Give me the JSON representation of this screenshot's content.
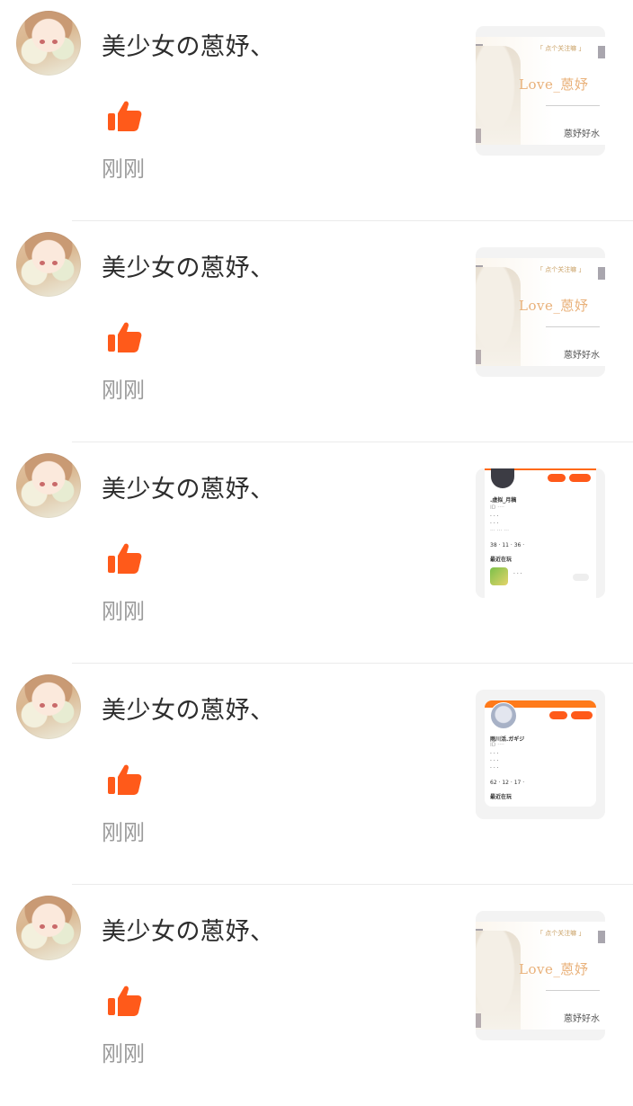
{
  "notifications": [
    {
      "user": "美少女の蒽妤、",
      "time": "刚刚",
      "thumbnail": "signature-banner"
    },
    {
      "user": "美少女の蒽妤、",
      "time": "刚刚",
      "thumbnail": "signature-banner"
    },
    {
      "user": "美少女の蒽妤、",
      "time": "刚刚",
      "thumbnail": "profile-screenshot-a"
    },
    {
      "user": "美少女の蒽妤、",
      "time": "刚刚",
      "thumbnail": "profile-screenshot-b"
    },
    {
      "user": "美少女の蒽妤、",
      "time": "刚刚",
      "thumbnail": "signature-banner"
    }
  ],
  "like_icon": "thumbs-up-icon",
  "colors": {
    "accent": "#ff5a1a",
    "divider": "#ebebeb",
    "time": "#9b9b9b"
  }
}
